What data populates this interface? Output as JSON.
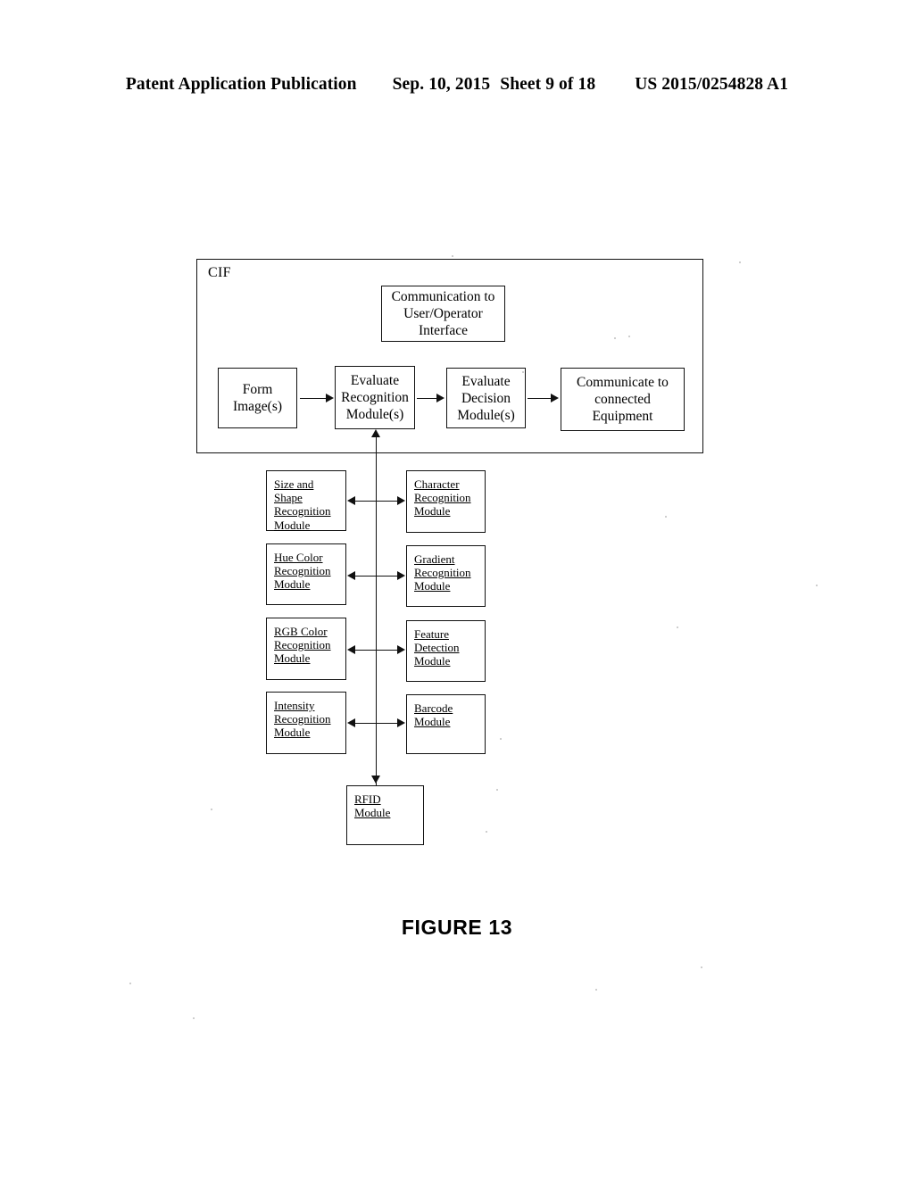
{
  "header": {
    "publication": "Patent Application Publication",
    "date": "Sep. 10, 2015",
    "sheet": "Sheet 9 of 18",
    "patent_number": "US 2015/0254828 A1"
  },
  "figure": {
    "caption": "FIGURE 13",
    "container_label": "CIF"
  },
  "flow": {
    "communication_ui": "Communication to\nUser/Operator\nInterface",
    "communication_ui_lines": [
      "Communication to",
      "User/Operator",
      "Interface"
    ],
    "steps": [
      {
        "id": "form-image",
        "lines": [
          "Form",
          "Image(s)"
        ]
      },
      {
        "id": "eval-recognition",
        "lines": [
          "Evaluate",
          "Recognition",
          "Module(s)"
        ]
      },
      {
        "id": "eval-decision",
        "lines": [
          "Evaluate",
          "Decision",
          "Module(s)"
        ]
      },
      {
        "id": "communicate",
        "lines": [
          "Communicate to",
          "connected",
          "Equipment"
        ]
      }
    ]
  },
  "modules": {
    "left_column": [
      {
        "id": "size-shape",
        "lines": [
          "Size and",
          "Shape",
          "Recognition",
          "Module"
        ]
      },
      {
        "id": "hue-color",
        "lines": [
          "Hue Color",
          "Recognition",
          "Module"
        ]
      },
      {
        "id": "rgb-color",
        "lines": [
          "RGB Color",
          "Recognition",
          "Module"
        ]
      },
      {
        "id": "intensity",
        "lines": [
          "Intensity",
          "Recognition",
          "Module"
        ]
      }
    ],
    "right_column": [
      {
        "id": "character",
        "lines": [
          "Character",
          "Recognition",
          "Module"
        ]
      },
      {
        "id": "gradient",
        "lines": [
          "Gradient",
          "Recognition",
          "Module"
        ]
      },
      {
        "id": "feature",
        "lines": [
          "Feature",
          "Detection",
          "Module"
        ]
      },
      {
        "id": "barcode",
        "lines": [
          "Barcode",
          "Module"
        ]
      }
    ],
    "bottom": {
      "id": "rfid",
      "lines": [
        "RFID",
        "Module"
      ]
    }
  },
  "colors": {
    "ink": "#111111",
    "page": "#ffffff"
  }
}
